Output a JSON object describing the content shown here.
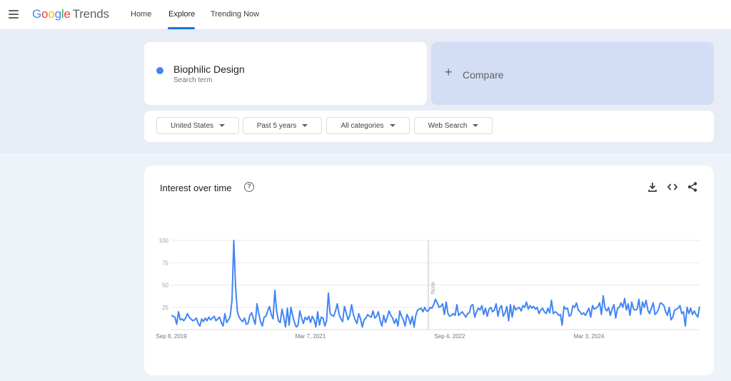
{
  "header": {
    "logo_google": [
      "G",
      "o",
      "o",
      "g",
      "l",
      "e"
    ],
    "logo_trends": "Trends",
    "nav": [
      {
        "label": "Home",
        "active": false
      },
      {
        "label": "Explore",
        "active": true
      },
      {
        "label": "Trending Now",
        "active": false
      }
    ]
  },
  "search": {
    "term": "Biophilic Design",
    "term_subtitle": "Search term",
    "term_color": "#4285f4",
    "compare_label": "Compare"
  },
  "filters": [
    {
      "label": "United States"
    },
    {
      "label": "Past 5 years"
    },
    {
      "label": "All categories"
    },
    {
      "label": "Web Search"
    }
  ],
  "chart_panel": {
    "title": "Interest over time",
    "note_label": "Note",
    "icons": [
      "help-icon",
      "download-icon",
      "embed-icon",
      "share-icon"
    ]
  },
  "chart_data": {
    "type": "line",
    "title": "Interest over time",
    "series": [
      {
        "color": "#4285f4",
        "values": [
          16,
          15,
          14,
          6,
          20,
          11,
          12,
          10,
          13,
          18,
          14,
          12,
          10,
          11,
          13,
          7,
          4,
          12,
          9,
          13,
          10,
          14,
          11,
          13,
          15,
          10,
          12,
          14,
          8,
          4,
          18,
          8,
          11,
          15,
          33,
          100,
          48,
          20,
          14,
          11,
          9,
          13,
          6,
          7,
          16,
          19,
          12,
          6,
          29,
          18,
          9,
          4,
          14,
          15,
          21,
          26,
          17,
          12,
          44,
          21,
          10,
          8,
          23,
          14,
          3,
          24,
          5,
          25,
          16,
          8,
          3,
          5,
          21,
          13,
          7,
          14,
          11,
          15,
          8,
          15,
          11,
          3,
          20,
          5,
          14,
          13,
          4,
          10,
          41,
          18,
          16,
          15,
          21,
          29,
          17,
          12,
          9,
          26,
          19,
          11,
          16,
          28,
          17,
          11,
          7,
          18,
          12,
          3,
          11,
          13,
          17,
          15,
          14,
          21,
          13,
          15,
          20,
          10,
          4,
          16,
          8,
          14,
          21,
          16,
          13,
          7,
          12,
          4,
          21,
          15,
          11,
          4,
          17,
          13,
          6,
          15,
          3,
          16,
          22,
          23,
          24,
          20,
          25,
          21,
          21,
          25,
          24,
          28,
          34,
          30,
          25,
          26,
          29,
          17,
          31,
          18,
          15,
          16,
          18,
          16,
          28,
          16,
          18,
          20,
          17,
          14,
          18,
          19,
          27,
          28,
          14,
          20,
          24,
          22,
          27,
          17,
          24,
          15,
          23,
          25,
          20,
          22,
          29,
          15,
          24,
          27,
          15,
          19,
          26,
          10,
          28,
          14,
          27,
          22,
          24,
          25,
          21,
          27,
          25,
          31,
          23,
          27,
          24,
          26,
          23,
          25,
          18,
          22,
          24,
          20,
          18,
          24,
          19,
          33,
          18,
          20,
          19,
          16,
          17,
          5,
          26,
          23,
          24,
          15,
          17,
          27,
          25,
          30,
          22,
          20,
          17,
          19,
          16,
          20,
          24,
          14,
          27,
          23,
          24,
          26,
          30,
          17,
          38,
          24,
          21,
          25,
          16,
          23,
          28,
          13,
          24,
          25,
          30,
          25,
          35,
          22,
          29,
          16,
          31,
          23,
          22,
          23,
          34,
          17,
          31,
          25,
          33,
          22,
          18,
          24,
          30,
          17,
          19,
          23,
          30,
          29,
          27,
          20,
          16,
          25,
          11,
          14,
          22,
          23,
          24,
          27,
          18,
          20,
          4,
          25,
          18,
          24,
          17,
          21,
          17,
          14,
          26
        ]
      }
    ],
    "x_ticks": [
      "Sep 8, 2019",
      "Mar 7, 2021",
      "Sep 4, 2022",
      "Mar 3, 2024"
    ],
    "y_ticks": [
      "25",
      "50",
      "75",
      "100"
    ],
    "ylim": [
      0,
      100
    ],
    "grid": true,
    "note_marker_index": 144
  }
}
